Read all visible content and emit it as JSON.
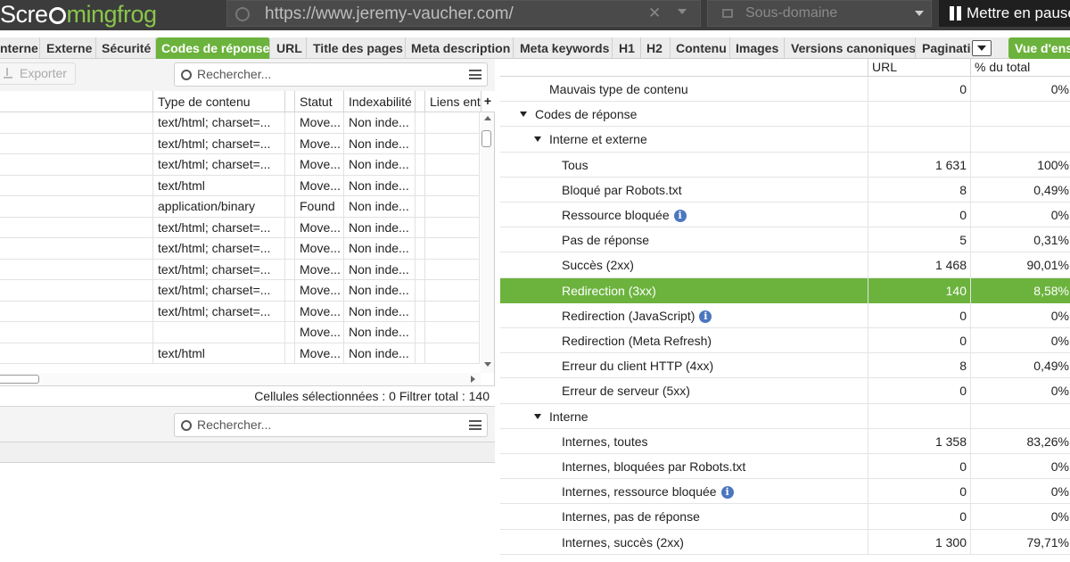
{
  "app": {
    "logo_pre": "Scre",
    "logo_post": "mingfrog",
    "url": "https://www.jeremy-vaucher.com/",
    "url_clear": "✕",
    "mode": "Sous-domaine",
    "pause_label": "Mettre en pause"
  },
  "colors": {
    "accent": "#6cb33e",
    "topbar": "#3c3c3c",
    "info": "#4b77c0"
  },
  "tabs": [
    {
      "label": "nterne"
    },
    {
      "label": "Externe"
    },
    {
      "label": "Sécurité"
    },
    {
      "label": "Codes de réponse",
      "active": true
    },
    {
      "label": "URL"
    },
    {
      "label": "Title des pages"
    },
    {
      "label": "Meta description"
    },
    {
      "label": "Meta keywords"
    },
    {
      "label": "H1"
    },
    {
      "label": "H2"
    },
    {
      "label": "Contenu"
    },
    {
      "label": "Images"
    },
    {
      "label": "Versions canoniques"
    },
    {
      "label": "Paginati"
    }
  ],
  "overview_button": "Vue d'ens",
  "left": {
    "export_label": "Exporter",
    "search_placeholder": "Rechercher...",
    "columns": [
      "Type de contenu",
      "Statut",
      "Indexabilité",
      "Liens ent"
    ],
    "add_column": "+",
    "rows": [
      [
        "text/html; charset=...",
        "Move...",
        "Non inde..."
      ],
      [
        "text/html; charset=...",
        "Move...",
        "Non inde..."
      ],
      [
        "text/html; charset=...",
        "Move...",
        "Non inde..."
      ],
      [
        "text/html",
        "Move...",
        "Non inde..."
      ],
      [
        "application/binary",
        "Found",
        "Non inde..."
      ],
      [
        "text/html; charset=...",
        "Move...",
        "Non inde..."
      ],
      [
        "text/html; charset=...",
        "Move...",
        "Non inde..."
      ],
      [
        "text/html; charset=...",
        "Move...",
        "Non inde..."
      ],
      [
        "text/html; charset=...",
        "Move...",
        "Non inde..."
      ],
      [
        "text/html; charset=...",
        "Move...",
        "Non inde..."
      ],
      [
        "",
        "Move...",
        "Non inde..."
      ],
      [
        "text/html",
        "Move...",
        "Non inde..."
      ]
    ],
    "status": "Cellules sélectionnées :  0  Filtrer total :  140",
    "bottom_search_placeholder": "Rechercher..."
  },
  "right": {
    "columns": [
      "URL",
      "% du total"
    ],
    "rows": [
      {
        "label": "Mauvais type de contenu",
        "level": 2,
        "url": "0",
        "pct": "0%"
      },
      {
        "label": "Codes de réponse",
        "level": 0,
        "expand": true,
        "url": "",
        "pct": ""
      },
      {
        "label": "Interne et externe",
        "level": 1,
        "expand": true,
        "url": "",
        "pct": ""
      },
      {
        "label": "Tous",
        "level": 3,
        "url": "1 631",
        "pct": "100%"
      },
      {
        "label": "Bloqué par Robots.txt",
        "level": 3,
        "url": "8",
        "pct": "0,49%"
      },
      {
        "label": "Ressource bloquée",
        "level": 3,
        "info": true,
        "url": "0",
        "pct": "0%"
      },
      {
        "label": "Pas de réponse",
        "level": 3,
        "url": "5",
        "pct": "0,31%"
      },
      {
        "label": "Succès (2xx)",
        "level": 3,
        "url": "1 468",
        "pct": "90,01%"
      },
      {
        "label": "Redirection (3xx)",
        "level": 3,
        "selected": true,
        "url": "140",
        "pct": "8,58%"
      },
      {
        "label": "Redirection (JavaScript)",
        "level": 3,
        "info": true,
        "url": "0",
        "pct": "0%"
      },
      {
        "label": "Redirection (Meta Refresh)",
        "level": 3,
        "url": "0",
        "pct": "0%"
      },
      {
        "label": "Erreur du client HTTP (4xx)",
        "level": 3,
        "url": "8",
        "pct": "0,49%"
      },
      {
        "label": "Erreur de serveur (5xx)",
        "level": 3,
        "url": "0",
        "pct": "0%"
      },
      {
        "label": "Interne",
        "level": 1,
        "expand": true,
        "url": "",
        "pct": ""
      },
      {
        "label": "Internes, toutes",
        "level": 3,
        "url": "1 358",
        "pct": "83,26%"
      },
      {
        "label": "Internes, bloquées par Robots.txt",
        "level": 3,
        "url": "0",
        "pct": "0%"
      },
      {
        "label": "Internes, ressource bloquée",
        "level": 3,
        "info": true,
        "url": "0",
        "pct": "0%"
      },
      {
        "label": "Internes, pas de réponse",
        "level": 3,
        "url": "0",
        "pct": "0%"
      },
      {
        "label": "Internes, succès (2xx)",
        "level": 3,
        "url": "1 300",
        "pct": "79,71%"
      }
    ]
  }
}
